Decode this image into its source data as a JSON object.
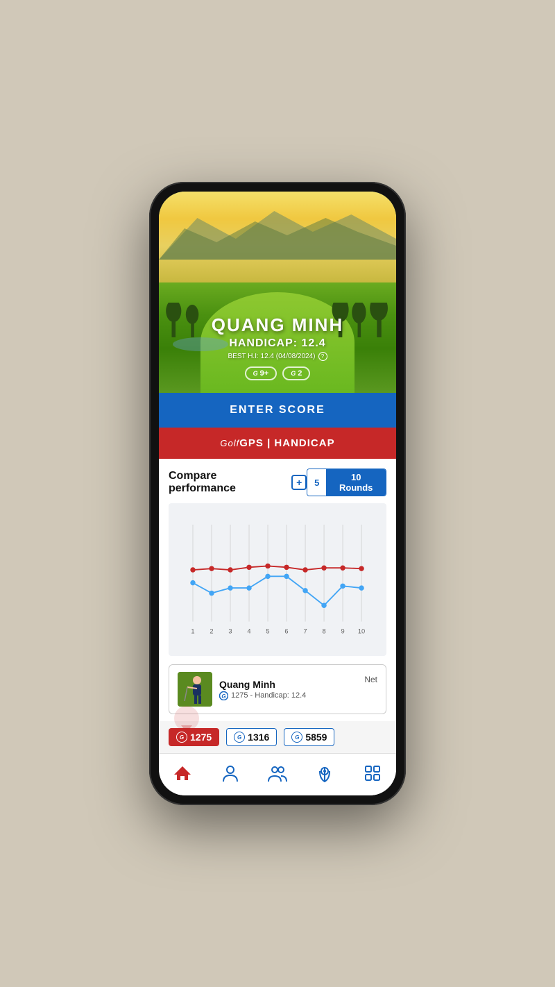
{
  "player": {
    "name": "QUANG MINH",
    "handicap_label": "HANDICAP: 12.4",
    "best_hi": "BEST H.I: 12.4 (04/08/2024)",
    "badge1": "9+",
    "badge2": "2"
  },
  "buttons": {
    "enter_score": "ENTER SCORE",
    "gps_brand": "Golf",
    "gps_label": "GPS | HANDICAP"
  },
  "compare": {
    "title": "Compare performance",
    "toggle_5": "5",
    "toggle_10": "10 Rounds"
  },
  "chart": {
    "x_labels": [
      "1",
      "2",
      "3",
      "4",
      "5",
      "6",
      "7",
      "8",
      "9",
      "10"
    ],
    "red_line": [
      42,
      43,
      42,
      43,
      44,
      43,
      42,
      43,
      43,
      43
    ],
    "blue_line": [
      52,
      58,
      55,
      55,
      48,
      48,
      56,
      62,
      53,
      55
    ]
  },
  "player_card": {
    "name": "Quang Minh",
    "detail": "1275 - Handicap: 12.4",
    "net_label": "Net"
  },
  "scores": {
    "score1": "1275",
    "score2": "1316",
    "score3": "5859"
  },
  "nav": {
    "items": [
      "home",
      "person",
      "group",
      "location",
      "grid"
    ]
  }
}
